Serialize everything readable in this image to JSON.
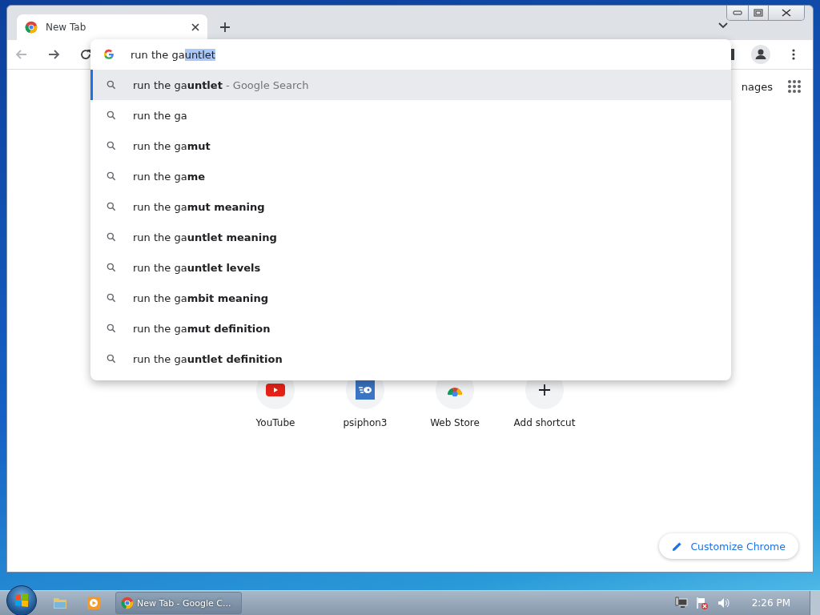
{
  "tabs": [
    {
      "label": "New Tab",
      "selected": true
    }
  ],
  "omnibox": {
    "typed": "run the ga",
    "autocomplete": "untlet"
  },
  "suggestions": [
    {
      "text": "run the ga**untlet**",
      "suffix": " - Google Search",
      "selected": true
    },
    {
      "text": "run the ga",
      "selected": false
    },
    {
      "text": "run the ga**mut**",
      "selected": false
    },
    {
      "text": "run the ga**me**",
      "selected": false
    },
    {
      "text": "run the ga**mut meaning**",
      "selected": false
    },
    {
      "text": "run the ga**untlet meaning**",
      "selected": false
    },
    {
      "text": "run the ga**untlet levels**",
      "selected": false
    },
    {
      "text": "run the ga**mbit meaning**",
      "selected": false
    },
    {
      "text": "run the ga**mut definition**",
      "selected": false
    },
    {
      "text": "run the ga**untlet definition**",
      "selected": false
    }
  ],
  "header_link": "nages",
  "shortcuts": [
    {
      "kind": "youtube",
      "label": "YouTube"
    },
    {
      "kind": "psiphon",
      "label": "psiphon3"
    },
    {
      "kind": "store",
      "label": "Web Store"
    },
    {
      "kind": "add",
      "label": "Add shortcut"
    }
  ],
  "customize_button": "Customize Chrome",
  "taskbar": {
    "window_button": "New Tab - Google C...",
    "clock": "2:26 PM"
  }
}
